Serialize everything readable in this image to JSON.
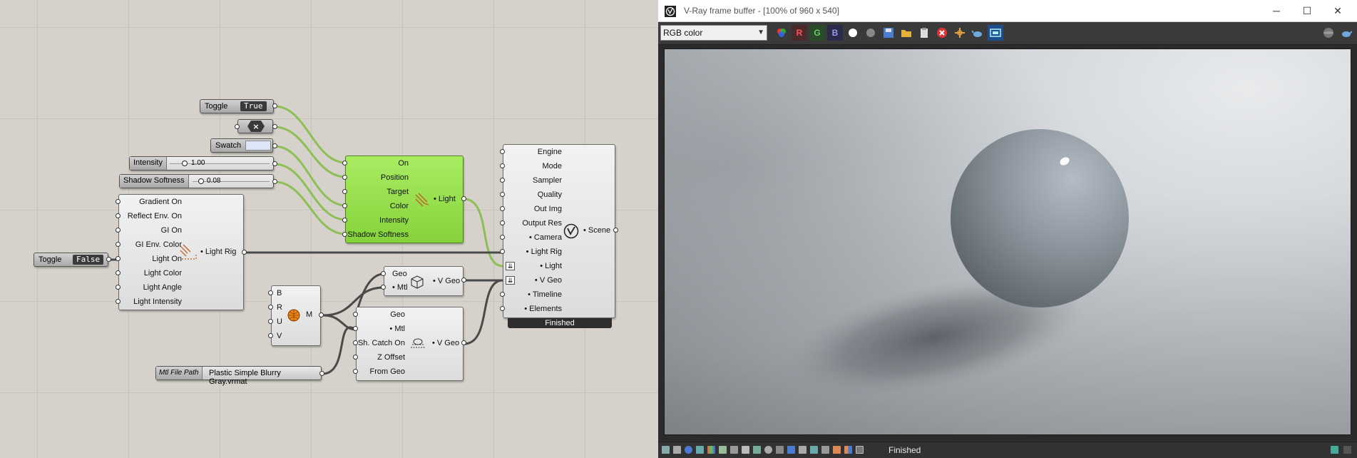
{
  "canvas": {
    "toggle_true": {
      "label": "Toggle",
      "value": "True"
    },
    "toggle_false": {
      "label": "Toggle",
      "value": "False"
    },
    "swatch": {
      "label": "Swatch",
      "color": "#dde6f7"
    },
    "intensity_slider": {
      "label": "Intensity",
      "value": "1.00"
    },
    "softness_slider": {
      "label": "Shadow Softness",
      "value": "0.08"
    },
    "light_component": {
      "inputs": [
        "On",
        "Position",
        "Target",
        "Color",
        "Intensity",
        "Shadow Softness"
      ],
      "output": "• Light"
    },
    "light_rig_component": {
      "inputs": [
        "Gradient On",
        "Reflect Env. On",
        "GI On",
        "GI Env. Color",
        "Light On",
        "Light Color",
        "Light Angle",
        "Light Intensity"
      ],
      "output": "• Light Rig"
    },
    "material_component": {
      "inputs": [
        "B",
        "R",
        "U",
        "V"
      ],
      "output": "M"
    },
    "geo_component": {
      "inputs": [
        "Geo",
        "• Mtl"
      ],
      "output": "• V Geo"
    },
    "shadow_catcher_component": {
      "inputs": [
        "Geo",
        "• Mtl",
        "Sh. Catch On",
        "Z Offset",
        "From Geo"
      ],
      "output": "• V Geo"
    },
    "mtl_file_path": {
      "label": "Mtl File Path",
      "value": "Plastic Simple Blurry Gray.vrmat"
    },
    "render_component": {
      "inputs": [
        "Engine",
        "Mode",
        "Sampler",
        "Quality",
        "Out Img",
        "Output Res",
        "• Camera",
        "• Light Rig",
        "• Light",
        "• V Geo",
        "• Timeline",
        "• Elements"
      ],
      "output": "• Scene",
      "status": "Finished"
    }
  },
  "vfb": {
    "title": "V-Ray frame buffer - [100% of 960 x 540]",
    "channel_select": "RGB color",
    "channel_buttons": [
      "R",
      "G",
      "B"
    ],
    "status_text": "Finished",
    "window_controls": {
      "minimize": "─",
      "maximize": "☐",
      "close": "✕"
    }
  }
}
